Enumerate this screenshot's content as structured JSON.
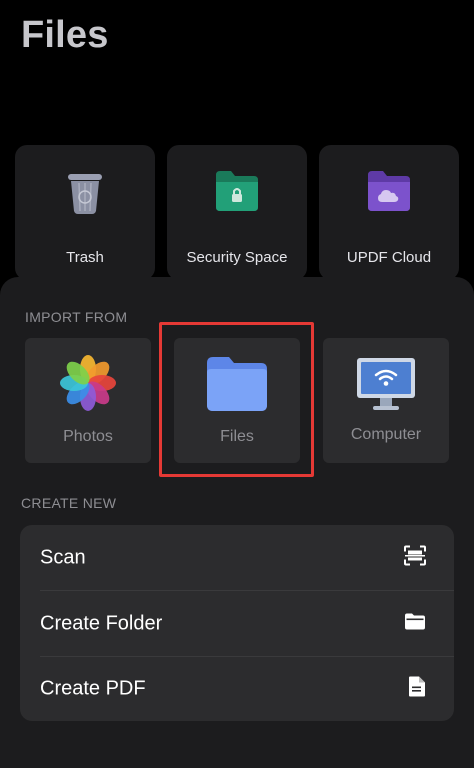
{
  "header": {
    "title": "Files"
  },
  "top_items": [
    {
      "label": "Trash",
      "icon": "trash-icon"
    },
    {
      "label": "Security Space",
      "icon": "lock-folder-icon",
      "color": "#1f8f6a"
    },
    {
      "label": "UPDF Cloud",
      "icon": "cloud-folder-icon",
      "color": "#7a4fc9"
    }
  ],
  "import_from": {
    "label": "IMPORT FROM",
    "items": [
      {
        "label": "Photos",
        "icon": "photos-icon"
      },
      {
        "label": "Files",
        "icon": "folder-icon",
        "color": "#6e9cf6"
      },
      {
        "label": "Computer",
        "icon": "monitor-wifi-icon"
      }
    ]
  },
  "create_new": {
    "label": "CREATE NEW",
    "items": [
      {
        "label": "Scan",
        "icon": "scan-icon"
      },
      {
        "label": "Create Folder",
        "icon": "folder-icon"
      },
      {
        "label": "Create PDF",
        "icon": "document-icon"
      }
    ]
  },
  "colors": {
    "highlight": "#e53935",
    "background": "#000000",
    "card": "#1c1c1e"
  }
}
